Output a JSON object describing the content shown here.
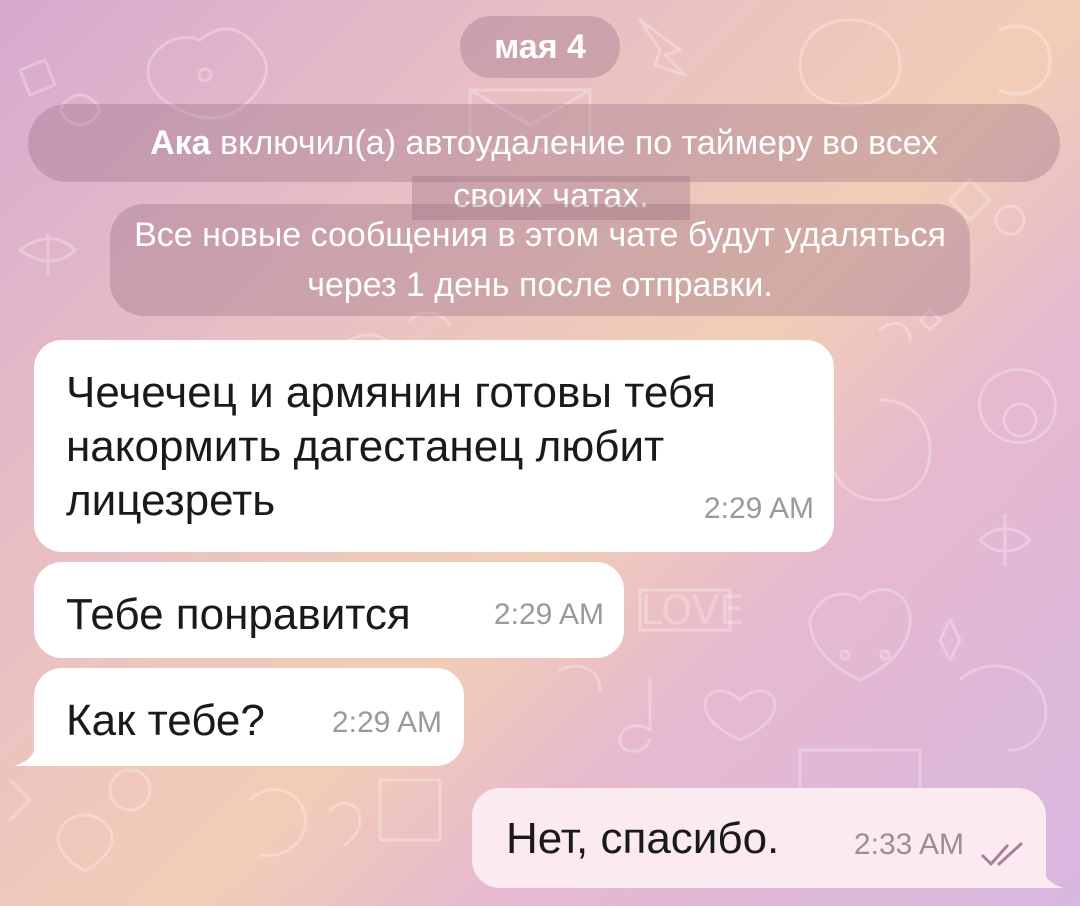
{
  "chat": {
    "date_label": "мая 4",
    "system_message": {
      "actor": "Ака",
      "line1_rest": " включил(а) автоудаление по таймеру во всех",
      "line2": "своих чатах.",
      "line3": "Все новые сообщения в этом чате будут удаляться через 1 день после отправки."
    },
    "messages": [
      {
        "direction": "incoming",
        "text": "Чечечец и армянин готовы тебя накормить дагестанец любит лицезреть",
        "time": "2:29 AM"
      },
      {
        "direction": "incoming",
        "text": "Тебе понравится",
        "time": "2:29 AM"
      },
      {
        "direction": "incoming",
        "text": "Как тебе?",
        "time": "2:29 AM"
      },
      {
        "direction": "outgoing",
        "text": "Нет, спасибо.",
        "time": "2:33 AM",
        "status_icon": "double-check-icon"
      }
    ]
  },
  "colors": {
    "incoming_bubble": "#ffffff",
    "outgoing_bubble": "#fbeaf0",
    "read_check": "#a77fa0",
    "service_pill": "rgba(150,110,130,0.35)"
  }
}
